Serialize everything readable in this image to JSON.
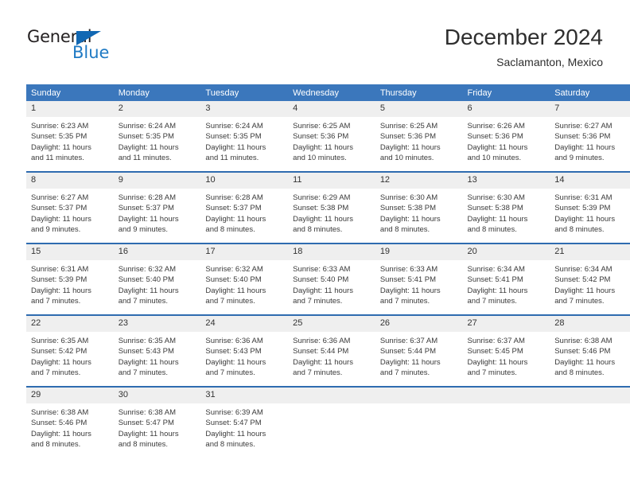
{
  "logo": {
    "word_general": "General",
    "word_blue": "Blue"
  },
  "header": {
    "title": "December 2024",
    "subtitle": "Saclamanton, Mexico"
  },
  "colors": {
    "header_blue": "#3b77bc",
    "row_divider_blue": "#2f6cb0",
    "daynum_band": "#efefef",
    "logo_blue": "#1f7ac4",
    "text": "#3a3a3a"
  },
  "weekdays": [
    "Sunday",
    "Monday",
    "Tuesday",
    "Wednesday",
    "Thursday",
    "Friday",
    "Saturday"
  ],
  "weeks": [
    [
      {
        "day": "1",
        "sunrise": "Sunrise: 6:23 AM",
        "sunset": "Sunset: 5:35 PM",
        "daylight1": "Daylight: 11 hours",
        "daylight2": "and 11 minutes."
      },
      {
        "day": "2",
        "sunrise": "Sunrise: 6:24 AM",
        "sunset": "Sunset: 5:35 PM",
        "daylight1": "Daylight: 11 hours",
        "daylight2": "and 11 minutes."
      },
      {
        "day": "3",
        "sunrise": "Sunrise: 6:24 AM",
        "sunset": "Sunset: 5:35 PM",
        "daylight1": "Daylight: 11 hours",
        "daylight2": "and 11 minutes."
      },
      {
        "day": "4",
        "sunrise": "Sunrise: 6:25 AM",
        "sunset": "Sunset: 5:36 PM",
        "daylight1": "Daylight: 11 hours",
        "daylight2": "and 10 minutes."
      },
      {
        "day": "5",
        "sunrise": "Sunrise: 6:25 AM",
        "sunset": "Sunset: 5:36 PM",
        "daylight1": "Daylight: 11 hours",
        "daylight2": "and 10 minutes."
      },
      {
        "day": "6",
        "sunrise": "Sunrise: 6:26 AM",
        "sunset": "Sunset: 5:36 PM",
        "daylight1": "Daylight: 11 hours",
        "daylight2": "and 10 minutes."
      },
      {
        "day": "7",
        "sunrise": "Sunrise: 6:27 AM",
        "sunset": "Sunset: 5:36 PM",
        "daylight1": "Daylight: 11 hours",
        "daylight2": "and 9 minutes."
      }
    ],
    [
      {
        "day": "8",
        "sunrise": "Sunrise: 6:27 AM",
        "sunset": "Sunset: 5:37 PM",
        "daylight1": "Daylight: 11 hours",
        "daylight2": "and 9 minutes."
      },
      {
        "day": "9",
        "sunrise": "Sunrise: 6:28 AM",
        "sunset": "Sunset: 5:37 PM",
        "daylight1": "Daylight: 11 hours",
        "daylight2": "and 9 minutes."
      },
      {
        "day": "10",
        "sunrise": "Sunrise: 6:28 AM",
        "sunset": "Sunset: 5:37 PM",
        "daylight1": "Daylight: 11 hours",
        "daylight2": "and 8 minutes."
      },
      {
        "day": "11",
        "sunrise": "Sunrise: 6:29 AM",
        "sunset": "Sunset: 5:38 PM",
        "daylight1": "Daylight: 11 hours",
        "daylight2": "and 8 minutes."
      },
      {
        "day": "12",
        "sunrise": "Sunrise: 6:30 AM",
        "sunset": "Sunset: 5:38 PM",
        "daylight1": "Daylight: 11 hours",
        "daylight2": "and 8 minutes."
      },
      {
        "day": "13",
        "sunrise": "Sunrise: 6:30 AM",
        "sunset": "Sunset: 5:38 PM",
        "daylight1": "Daylight: 11 hours",
        "daylight2": "and 8 minutes."
      },
      {
        "day": "14",
        "sunrise": "Sunrise: 6:31 AM",
        "sunset": "Sunset: 5:39 PM",
        "daylight1": "Daylight: 11 hours",
        "daylight2": "and 8 minutes."
      }
    ],
    [
      {
        "day": "15",
        "sunrise": "Sunrise: 6:31 AM",
        "sunset": "Sunset: 5:39 PM",
        "daylight1": "Daylight: 11 hours",
        "daylight2": "and 7 minutes."
      },
      {
        "day": "16",
        "sunrise": "Sunrise: 6:32 AM",
        "sunset": "Sunset: 5:40 PM",
        "daylight1": "Daylight: 11 hours",
        "daylight2": "and 7 minutes."
      },
      {
        "day": "17",
        "sunrise": "Sunrise: 6:32 AM",
        "sunset": "Sunset: 5:40 PM",
        "daylight1": "Daylight: 11 hours",
        "daylight2": "and 7 minutes."
      },
      {
        "day": "18",
        "sunrise": "Sunrise: 6:33 AM",
        "sunset": "Sunset: 5:40 PM",
        "daylight1": "Daylight: 11 hours",
        "daylight2": "and 7 minutes."
      },
      {
        "day": "19",
        "sunrise": "Sunrise: 6:33 AM",
        "sunset": "Sunset: 5:41 PM",
        "daylight1": "Daylight: 11 hours",
        "daylight2": "and 7 minutes."
      },
      {
        "day": "20",
        "sunrise": "Sunrise: 6:34 AM",
        "sunset": "Sunset: 5:41 PM",
        "daylight1": "Daylight: 11 hours",
        "daylight2": "and 7 minutes."
      },
      {
        "day": "21",
        "sunrise": "Sunrise: 6:34 AM",
        "sunset": "Sunset: 5:42 PM",
        "daylight1": "Daylight: 11 hours",
        "daylight2": "and 7 minutes."
      }
    ],
    [
      {
        "day": "22",
        "sunrise": "Sunrise: 6:35 AM",
        "sunset": "Sunset: 5:42 PM",
        "daylight1": "Daylight: 11 hours",
        "daylight2": "and 7 minutes."
      },
      {
        "day": "23",
        "sunrise": "Sunrise: 6:35 AM",
        "sunset": "Sunset: 5:43 PM",
        "daylight1": "Daylight: 11 hours",
        "daylight2": "and 7 minutes."
      },
      {
        "day": "24",
        "sunrise": "Sunrise: 6:36 AM",
        "sunset": "Sunset: 5:43 PM",
        "daylight1": "Daylight: 11 hours",
        "daylight2": "and 7 minutes."
      },
      {
        "day": "25",
        "sunrise": "Sunrise: 6:36 AM",
        "sunset": "Sunset: 5:44 PM",
        "daylight1": "Daylight: 11 hours",
        "daylight2": "and 7 minutes."
      },
      {
        "day": "26",
        "sunrise": "Sunrise: 6:37 AM",
        "sunset": "Sunset: 5:44 PM",
        "daylight1": "Daylight: 11 hours",
        "daylight2": "and 7 minutes."
      },
      {
        "day": "27",
        "sunrise": "Sunrise: 6:37 AM",
        "sunset": "Sunset: 5:45 PM",
        "daylight1": "Daylight: 11 hours",
        "daylight2": "and 7 minutes."
      },
      {
        "day": "28",
        "sunrise": "Sunrise: 6:38 AM",
        "sunset": "Sunset: 5:46 PM",
        "daylight1": "Daylight: 11 hours",
        "daylight2": "and 8 minutes."
      }
    ],
    [
      {
        "day": "29",
        "sunrise": "Sunrise: 6:38 AM",
        "sunset": "Sunset: 5:46 PM",
        "daylight1": "Daylight: 11 hours",
        "daylight2": "and 8 minutes."
      },
      {
        "day": "30",
        "sunrise": "Sunrise: 6:38 AM",
        "sunset": "Sunset: 5:47 PM",
        "daylight1": "Daylight: 11 hours",
        "daylight2": "and 8 minutes."
      },
      {
        "day": "31",
        "sunrise": "Sunrise: 6:39 AM",
        "sunset": "Sunset: 5:47 PM",
        "daylight1": "Daylight: 11 hours",
        "daylight2": "and 8 minutes."
      },
      {
        "day": "",
        "sunrise": "",
        "sunset": "",
        "daylight1": "",
        "daylight2": ""
      },
      {
        "day": "",
        "sunrise": "",
        "sunset": "",
        "daylight1": "",
        "daylight2": ""
      },
      {
        "day": "",
        "sunrise": "",
        "sunset": "",
        "daylight1": "",
        "daylight2": ""
      },
      {
        "day": "",
        "sunrise": "",
        "sunset": "",
        "daylight1": "",
        "daylight2": ""
      }
    ]
  ]
}
